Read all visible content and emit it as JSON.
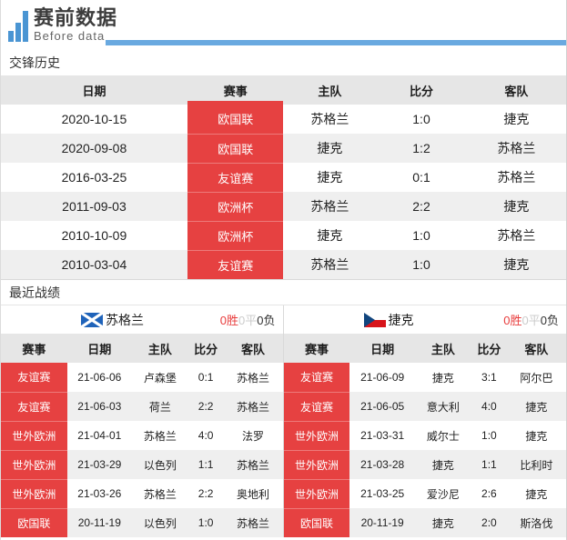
{
  "header": {
    "logo_title": "赛前数据",
    "logo_subtitle": "Before data"
  },
  "colors": {
    "accent_red": "#e64141",
    "accent_blue": "#69a9e0",
    "logo_bar_blue": "#4a95d3",
    "table_header_bg": "#e6e6e6",
    "row_stripe": "#efefef"
  },
  "h2h": {
    "title": "交锋历史",
    "columns": [
      "日期",
      "赛事",
      "主队",
      "比分",
      "客队"
    ],
    "rows": [
      {
        "date": "2020-10-15",
        "comp": "欧国联",
        "home": "苏格兰",
        "score": "1:0",
        "away": "捷克"
      },
      {
        "date": "2020-09-08",
        "comp": "欧国联",
        "home": "捷克",
        "score": "1:2",
        "away": "苏格兰"
      },
      {
        "date": "2016-03-25",
        "comp": "友谊赛",
        "home": "捷克",
        "score": "0:1",
        "away": "苏格兰"
      },
      {
        "date": "2011-09-03",
        "comp": "欧洲杯",
        "home": "苏格兰",
        "score": "2:2",
        "away": "捷克"
      },
      {
        "date": "2010-10-09",
        "comp": "欧洲杯",
        "home": "捷克",
        "score": "1:0",
        "away": "苏格兰"
      },
      {
        "date": "2010-03-04",
        "comp": "友谊赛",
        "home": "苏格兰",
        "score": "1:0",
        "away": "捷克"
      }
    ]
  },
  "recent": {
    "title": "最近战绩",
    "columns": [
      "赛事",
      "日期",
      "主队",
      "比分",
      "客队"
    ],
    "left": {
      "team": "苏格兰",
      "flag": "scotland-flag",
      "record": {
        "wins": "0胜",
        "draws": "0平",
        "losses": "0负"
      },
      "rows": [
        {
          "comp": "友谊赛",
          "date": "21-06-06",
          "home": "卢森堡",
          "score": "0:1",
          "away": "苏格兰"
        },
        {
          "comp": "友谊赛",
          "date": "21-06-03",
          "home": "荷兰",
          "score": "2:2",
          "away": "苏格兰"
        },
        {
          "comp": "世外欧洲",
          "date": "21-04-01",
          "home": "苏格兰",
          "score": "4:0",
          "away": "法罗"
        },
        {
          "comp": "世外欧洲",
          "date": "21-03-29",
          "home": "以色列",
          "score": "1:1",
          "away": "苏格兰"
        },
        {
          "comp": "世外欧洲",
          "date": "21-03-26",
          "home": "苏格兰",
          "score": "2:2",
          "away": "奥地利"
        },
        {
          "comp": "欧国联",
          "date": "20-11-19",
          "home": "以色列",
          "score": "1:0",
          "away": "苏格兰"
        }
      ]
    },
    "right": {
      "team": "捷克",
      "flag": "czech-flag",
      "record": {
        "wins": "0胜",
        "draws": "0平",
        "losses": "0负"
      },
      "rows": [
        {
          "comp": "友谊赛",
          "date": "21-06-09",
          "home": "捷克",
          "score": "3:1",
          "away": "阿尔巴"
        },
        {
          "comp": "友谊赛",
          "date": "21-06-05",
          "home": "意大利",
          "score": "4:0",
          "away": "捷克"
        },
        {
          "comp": "世外欧洲",
          "date": "21-03-31",
          "home": "威尔士",
          "score": "1:0",
          "away": "捷克"
        },
        {
          "comp": "世外欧洲",
          "date": "21-03-28",
          "home": "捷克",
          "score": "1:1",
          "away": "比利时"
        },
        {
          "comp": "世外欧洲",
          "date": "21-03-25",
          "home": "爱沙尼",
          "score": "2:6",
          "away": "捷克"
        },
        {
          "comp": "欧国联",
          "date": "20-11-19",
          "home": "捷克",
          "score": "2:0",
          "away": "斯洛伐"
        }
      ]
    }
  }
}
